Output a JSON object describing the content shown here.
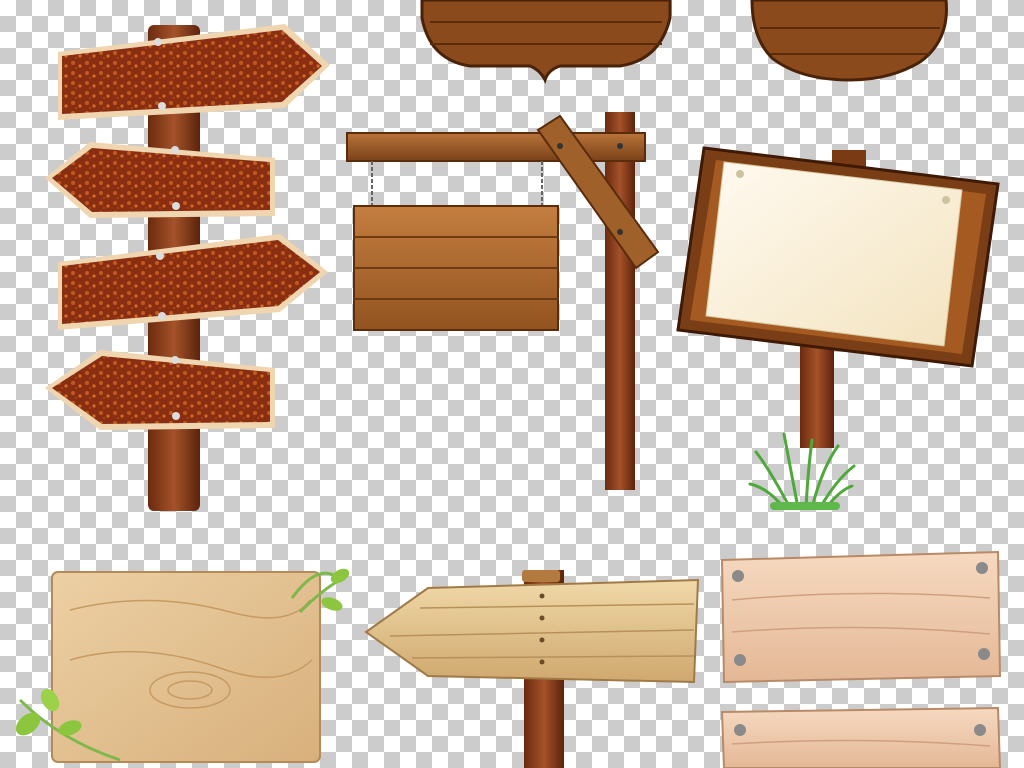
{
  "canvas": {
    "background": "transparency-checkerboard",
    "checker_colors": [
      "#ffffff",
      "#cccccc"
    ]
  },
  "colors": {
    "rusty_wood": "#8a2e12",
    "rust_spots": "#c25a1e",
    "medium_wood": "#a8642c",
    "dark_wood": "#6e3a14",
    "light_wood": "#e3c08e",
    "pale_wood": "#f2cfae",
    "paper": "#fbf1d6",
    "grass": "#5fb84a",
    "leaf": "#8cc63f"
  },
  "illustrations": [
    {
      "name": "rusty-arrow-signpost",
      "arrows": 4
    },
    {
      "name": "hanging-sign-on-gallows-post",
      "planks": 4
    },
    {
      "name": "notice-board-with-paper"
    },
    {
      "name": "decorative-hanging-plaque"
    },
    {
      "name": "round-wooden-sign"
    },
    {
      "name": "light-wood-board-with-vine"
    },
    {
      "name": "arrow-sign-on-post"
    },
    {
      "name": "pink-wood-plank-signs",
      "planks": 2
    }
  ]
}
